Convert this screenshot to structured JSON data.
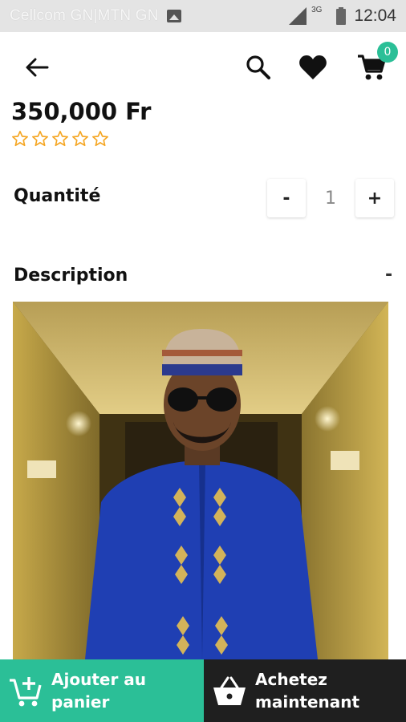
{
  "status_bar": {
    "carrier": "Cellcom GN|MTN GN",
    "network": "3G",
    "time": "12:04"
  },
  "top_bar": {
    "icons": [
      "back-arrow-icon",
      "search-icon",
      "heart-icon",
      "cart-icon"
    ],
    "cart_count": "0"
  },
  "product": {
    "price": "350,000 Fr",
    "rating_stars": 0,
    "rating_max": 5
  },
  "quantity": {
    "label": "Quantité",
    "minus_label": "-",
    "value": "1",
    "plus_label": "+"
  },
  "description": {
    "label": "Description",
    "toggle_label": "-"
  },
  "actions": {
    "add_to_cart_line1": "Ajouter au",
    "add_to_cart_line2": "panier",
    "buy_now_line1": "Achetez",
    "buy_now_line2": "maintenant"
  },
  "colors": {
    "accent": "#2bbf97",
    "star": "#f5a623",
    "buy_button": "#1f1f1f"
  }
}
